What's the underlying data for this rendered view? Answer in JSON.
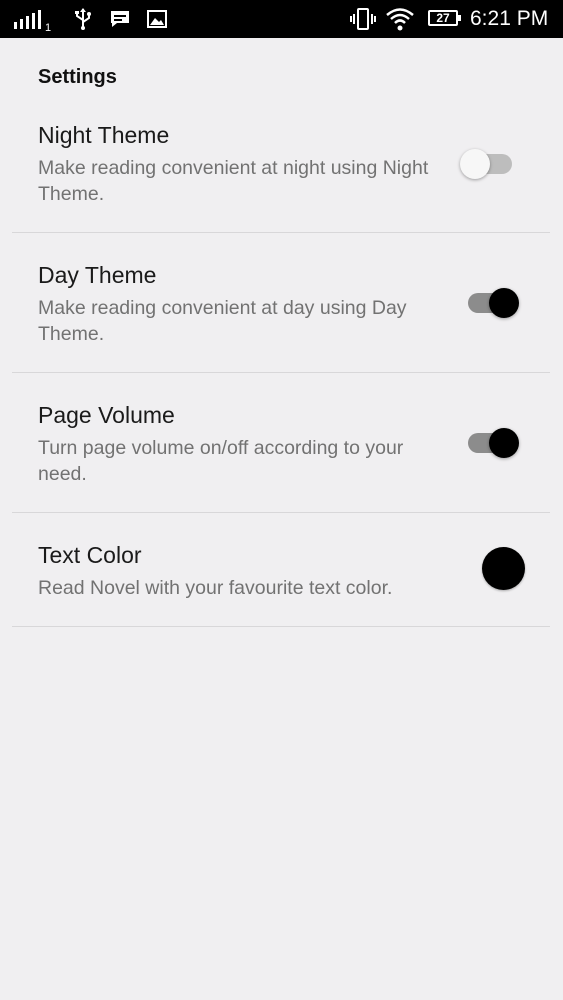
{
  "status_bar": {
    "sim_slot": "1",
    "battery_level": "27",
    "time": "6:21 PM",
    "icons": [
      "signal-icon",
      "usb-icon",
      "message-icon",
      "image-icon",
      "vibrate-icon",
      "wifi-icon",
      "battery-icon"
    ]
  },
  "settings": {
    "header": "Settings",
    "items": [
      {
        "title": "Night Theme",
        "description": "Make reading convenient at night using Night Theme.",
        "enabled": false
      },
      {
        "title": "Day Theme",
        "description": "Make reading convenient at day using Day Theme.",
        "enabled": true
      },
      {
        "title": "Page Volume",
        "description": "Turn page volume on/off according to your need.",
        "enabled": true
      },
      {
        "title": "Text Color",
        "description": "Read Novel with your favourite text color.",
        "color": "#000000"
      }
    ]
  },
  "colors": {
    "background": "#f0eff1",
    "status_bar": "#000000",
    "toggle_on_thumb": "#000000",
    "toggle_on_track": "#8c8c8c",
    "toggle_off_thumb": "#f7f7f7",
    "toggle_off_track": "#bdbdbd"
  }
}
